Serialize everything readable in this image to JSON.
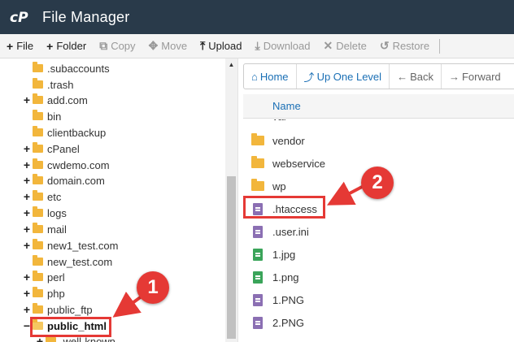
{
  "app": {
    "title": "File Manager"
  },
  "toolbar": {
    "items": [
      {
        "label": "File",
        "icon": "plus-icon",
        "enabled": true
      },
      {
        "label": "Folder",
        "icon": "plus-icon",
        "enabled": true
      },
      {
        "label": "Copy",
        "icon": "copy-icon",
        "enabled": false
      },
      {
        "label": "Move",
        "icon": "move-icon",
        "enabled": false
      },
      {
        "label": "Upload",
        "icon": "upload-icon",
        "enabled": true
      },
      {
        "label": "Download",
        "icon": "download-icon",
        "enabled": false
      },
      {
        "label": "Delete",
        "icon": "delete-icon",
        "enabled": false
      },
      {
        "label": "Restore",
        "icon": "restore-icon",
        "enabled": false
      }
    ]
  },
  "tree": {
    "items": [
      {
        "label": ".subaccounts",
        "expandable": false
      },
      {
        "label": ".trash",
        "expandable": false
      },
      {
        "label": "add.com",
        "expandable": true
      },
      {
        "label": "bin",
        "expandable": false
      },
      {
        "label": "clientbackup",
        "expandable": false
      },
      {
        "label": "cPanel",
        "expandable": true
      },
      {
        "label": "cwdemo.com",
        "expandable": true
      },
      {
        "label": "domain.com",
        "expandable": true
      },
      {
        "label": "etc",
        "expandable": true
      },
      {
        "label": "logs",
        "expandable": true
      },
      {
        "label": "mail",
        "expandable": true
      },
      {
        "label": "new1_test.com",
        "expandable": true
      },
      {
        "label": "new_test.com",
        "expandable": false
      },
      {
        "label": "perl",
        "expandable": true
      },
      {
        "label": "php",
        "expandable": true
      },
      {
        "label": "public_ftp",
        "expandable": true
      },
      {
        "label": "public_html",
        "expandable": true,
        "expanded": true,
        "selected": true
      },
      {
        "label": ".well-known",
        "expandable": true
      }
    ]
  },
  "nav": {
    "home": "Home",
    "up_one_level": "Up One Level",
    "back": "Back",
    "forward": "Forward"
  },
  "list": {
    "column_name": "Name",
    "files": [
      {
        "name": "var",
        "type": "folder"
      },
      {
        "name": "vendor",
        "type": "folder"
      },
      {
        "name": "webservice",
        "type": "folder"
      },
      {
        "name": "wp",
        "type": "folder"
      },
      {
        "name": ".htaccess",
        "type": "text"
      },
      {
        "name": ".user.ini",
        "type": "text"
      },
      {
        "name": "1.jpg",
        "type": "image"
      },
      {
        "name": "1.png",
        "type": "image"
      },
      {
        "name": "1.PNG",
        "type": "text"
      },
      {
        "name": "2.PNG",
        "type": "text"
      }
    ]
  },
  "annotations": {
    "badge1": "1",
    "badge2": "2",
    "color": "#e53935"
  }
}
